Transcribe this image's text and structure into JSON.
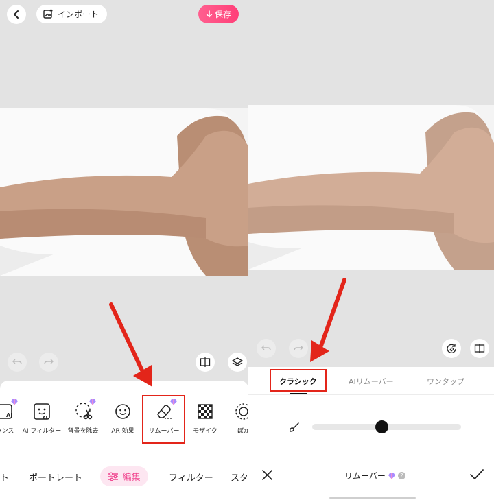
{
  "left": {
    "topbar": {
      "import_label": "インポート",
      "save_label": "保存"
    },
    "tools": [
      {
        "label": "ハンス"
      },
      {
        "label": "AI フィルター"
      },
      {
        "label": "背景を除去"
      },
      {
        "label": "AR 効果"
      },
      {
        "label": "リムーバー"
      },
      {
        "label": "モザイク"
      },
      {
        "label": "ぼか"
      }
    ],
    "bottom_nav": {
      "item_prev": "ト",
      "portrait": "ポートレート",
      "edit": "編集",
      "filter": "フィルター",
      "next": "スタ"
    }
  },
  "right": {
    "tabs": {
      "classic": "クラシック",
      "ai_remover": "AIリムーバー",
      "one_tap": "ワンタップ"
    },
    "brush_size": 0.47,
    "title": "リムーバー"
  },
  "colors": {
    "accent_pink": "#f0468f",
    "highlight_red": "#e3251a"
  }
}
